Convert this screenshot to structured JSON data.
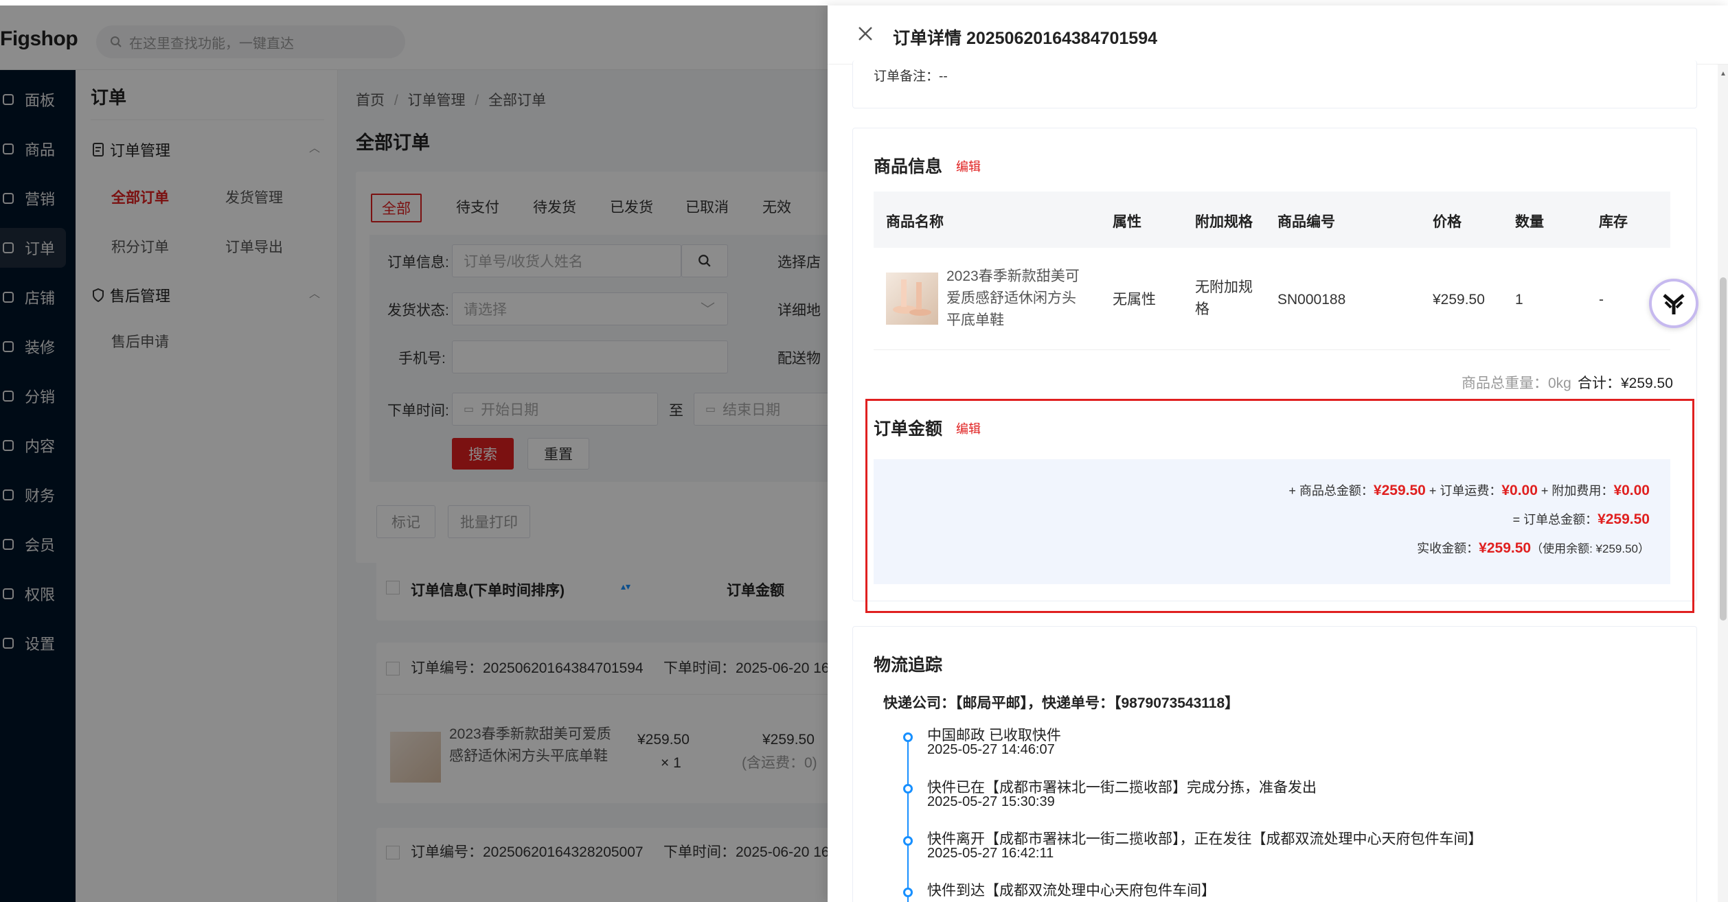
{
  "app": {
    "logo": "Figshop",
    "search_placeholder": "在这里查找功能，一键直达"
  },
  "sidebar": {
    "items": [
      {
        "label": "面板",
        "icon": "chart-icon"
      },
      {
        "label": "商品",
        "icon": "cube-icon"
      },
      {
        "label": "营销",
        "icon": "megaphone-icon"
      },
      {
        "label": "订单",
        "icon": "order-icon"
      },
      {
        "label": "店铺",
        "icon": "store-icon"
      },
      {
        "label": "装修",
        "icon": "brush-icon"
      },
      {
        "label": "分销",
        "icon": "share-icon"
      },
      {
        "label": "内容",
        "icon": "doc-icon"
      },
      {
        "label": "财务",
        "icon": "wallet-icon"
      },
      {
        "label": "会员",
        "icon": "member-icon"
      },
      {
        "label": "权限",
        "icon": "shield-icon"
      },
      {
        "label": "设置",
        "icon": "gear-icon"
      }
    ]
  },
  "submenu": {
    "title": "订单",
    "group1": "订单管理",
    "group1_links": [
      "全部订单",
      "发货管理",
      "积分订单",
      "订单导出"
    ],
    "group2": "售后管理",
    "group2_links": [
      "售后申请"
    ]
  },
  "main": {
    "breadcrumb": [
      "首页",
      "/",
      "订单管理",
      "/",
      "全部订单"
    ],
    "page_title": "全部订单",
    "tabs": [
      "全部",
      "待支付",
      "待发货",
      "已发货",
      "已取消",
      "无效"
    ],
    "filters": {
      "order_info_label": "订单信息:",
      "order_info_placeholder": "订单号/收货人姓名",
      "select_store_label": "选择店",
      "ship_status_label": "发货状态:",
      "ship_status_placeholder": "请选择",
      "detail_addr_label": "详细地",
      "phone_label": "手机号:",
      "delivery_label": "配送物",
      "order_time_label": "下单时间:",
      "start_date": "开始日期",
      "to": "至",
      "end_date": "结束日期",
      "search_btn": "搜索",
      "reset_btn": "重置"
    },
    "actions": [
      "标记",
      "批量打印"
    ],
    "table_head": {
      "order_info": "订单信息(下单时间排序)",
      "amount": "订单金额"
    },
    "orders": [
      {
        "no_label": "订单编号：20250620164384701594",
        "time_label": "下单时间：2025-06-20 16",
        "product": "2023春季新款甜美可爱质感舒适休闲方头平底单鞋",
        "price": "¥259.50",
        "qty": "× 1",
        "amount": "¥259.50",
        "freight": "(含运费：0)"
      },
      {
        "no_label": "订单编号：20250620164328205007",
        "time_label": "下单时间：2025-06-20 16"
      }
    ]
  },
  "drawer": {
    "title": "订单详情 20250620164384701594",
    "remark": "订单备注：--",
    "goods": {
      "title": "商品信息",
      "edit": "编辑",
      "headers": [
        "商品名称",
        "属性",
        "附加规格",
        "商品编号",
        "价格",
        "数量",
        "库存"
      ],
      "row": {
        "name_lines": [
          "2023春季新款甜美可",
          "爱质感舒适休闲方头",
          "平底单鞋"
        ],
        "attr": "无属性",
        "extra_lines": [
          "无附加规",
          "格"
        ],
        "sku": "SN000188",
        "price": "¥259.50",
        "qty": "1",
        "stock": "-"
      },
      "weight": "商品总重量：0kg",
      "total": "合计：¥259.50"
    },
    "amount": {
      "title": "订单金额",
      "edit": "编辑",
      "line1": {
        "p1": "+ 商品总金额：",
        "v1": "¥259.50",
        "p2": " + 订单运费：",
        "v2": "¥0.00",
        "p3": " + 附加费用：",
        "v3": "¥0.00"
      },
      "line2": {
        "p1": "= 订单总金额：",
        "v1": "¥259.50"
      },
      "line3": {
        "p1": "实收金额：",
        "v1": "¥259.50",
        "p2": "（使用余额: ¥259.50）"
      }
    },
    "logistics": {
      "title": "物流追踪",
      "company": "快递公司：【邮局平邮】，快递单号：【9879073543118】",
      "events": [
        {
          "text": "中国邮政 已收取快件",
          "time": "2025-05-27 14:46:07"
        },
        {
          "text": "快件已在【成都市署袜北一街二揽收部】完成分拣，准备发出",
          "time": "2025-05-27 15:30:39"
        },
        {
          "text": "快件离开【成都市署袜北一街二揽收部】，正在发往【成都双流处理中心天府包件车间】",
          "time": "2025-05-27 16:42:11"
        },
        {
          "text": "快件到达【成都双流处理中心天府包件车间】",
          "time": ""
        }
      ]
    }
  },
  "colors": {
    "accent": "#e02020",
    "sidebar_bg": "#001529",
    "timeline": "#1890ff"
  }
}
